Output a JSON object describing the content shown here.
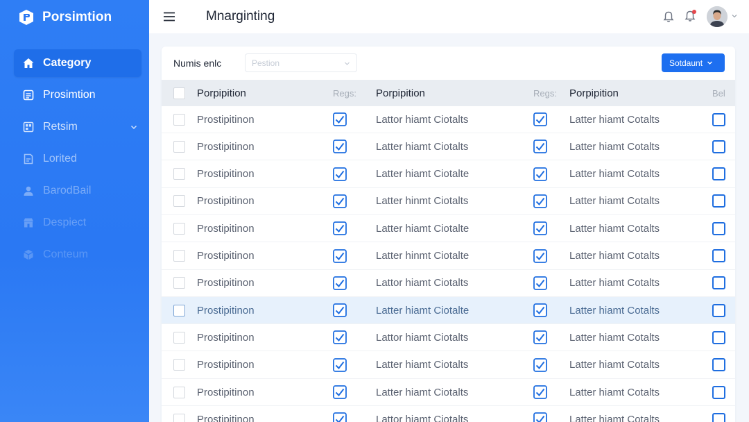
{
  "brand": {
    "name": "Porsimtion"
  },
  "sidebar": {
    "items": [
      {
        "label": "Category",
        "icon": "home-icon"
      },
      {
        "label": "Prosimtion",
        "icon": "list-icon"
      },
      {
        "label": "Retsim",
        "icon": "grid-icon"
      },
      {
        "label": "Lorited",
        "icon": "document-icon"
      },
      {
        "label": "BarodBail",
        "icon": "user-icon"
      },
      {
        "label": "Despiect",
        "icon": "shop-icon"
      },
      {
        "label": "Conteum",
        "icon": "cube-icon"
      }
    ]
  },
  "header": {
    "title": "Mnarginting"
  },
  "toolbar": {
    "filter_label": "Numis enlc",
    "select_placeholder": "Pestion",
    "primary_button": "Sotdaunt"
  },
  "table": {
    "headers": {
      "col_a": "Porpipition",
      "col_b": "Regs:",
      "col_c": "Porpipition",
      "col_d": "Regs:",
      "col_e": "Porpipition",
      "col_f": "Bel"
    },
    "rows": [
      {
        "a": "Prostipitinon",
        "c": "Lattor hiamt Ciotalts",
        "e": "Latter hiamt Cotalts"
      },
      {
        "a": "Prostipitinon",
        "c": "Latter hiamt Ciotalts",
        "e": "Latter hiamt Cotalts"
      },
      {
        "a": "Prostipitinon",
        "c": "Latter hiamt Ciotalte",
        "e": "Latter hiamt Cotalts"
      },
      {
        "a": "Prostipitinon",
        "c": "Latter hinmt Ciotalts",
        "e": "Latter hiamt Cotalts"
      },
      {
        "a": "Prostipitinon",
        "c": "Latter hiamt Ciotalte",
        "e": "Latter hiamt Cotalts"
      },
      {
        "a": "Prostipitinon",
        "c": "Latter hinmt Ciotalte",
        "e": "Latter hiamt Cotalts"
      },
      {
        "a": "Prostipitinon",
        "c": "Lattor hiamt Ciotalts",
        "e": "Latter hiamt Cotalts"
      },
      {
        "a": "Prostipitinon",
        "c": "Latter hiamt Ciotalte",
        "e": "Latter hiamt Cotalts"
      },
      {
        "a": "Prostipitinon",
        "c": "Lattor hiamt Ciotalts",
        "e": "Latter hiamt Cotalts"
      },
      {
        "a": "Prostipitinon",
        "c": "Latter hiamt Ciotalts",
        "e": "Latter hiamt Cotalts"
      },
      {
        "a": "Prostipitinon",
        "c": "Latter hiamt Ciotalts",
        "e": "Latter hiamt Cotalts"
      },
      {
        "a": "Prostipitinon",
        "c": "Lattor hiamt Ciotalts",
        "e": "Latter hiamt Cotalts"
      }
    ]
  },
  "colors": {
    "sidebar": "#2a78f3",
    "accent": "#1d6ff0",
    "highlight_row": "#e7f1fc",
    "notification": "#e5484d"
  }
}
